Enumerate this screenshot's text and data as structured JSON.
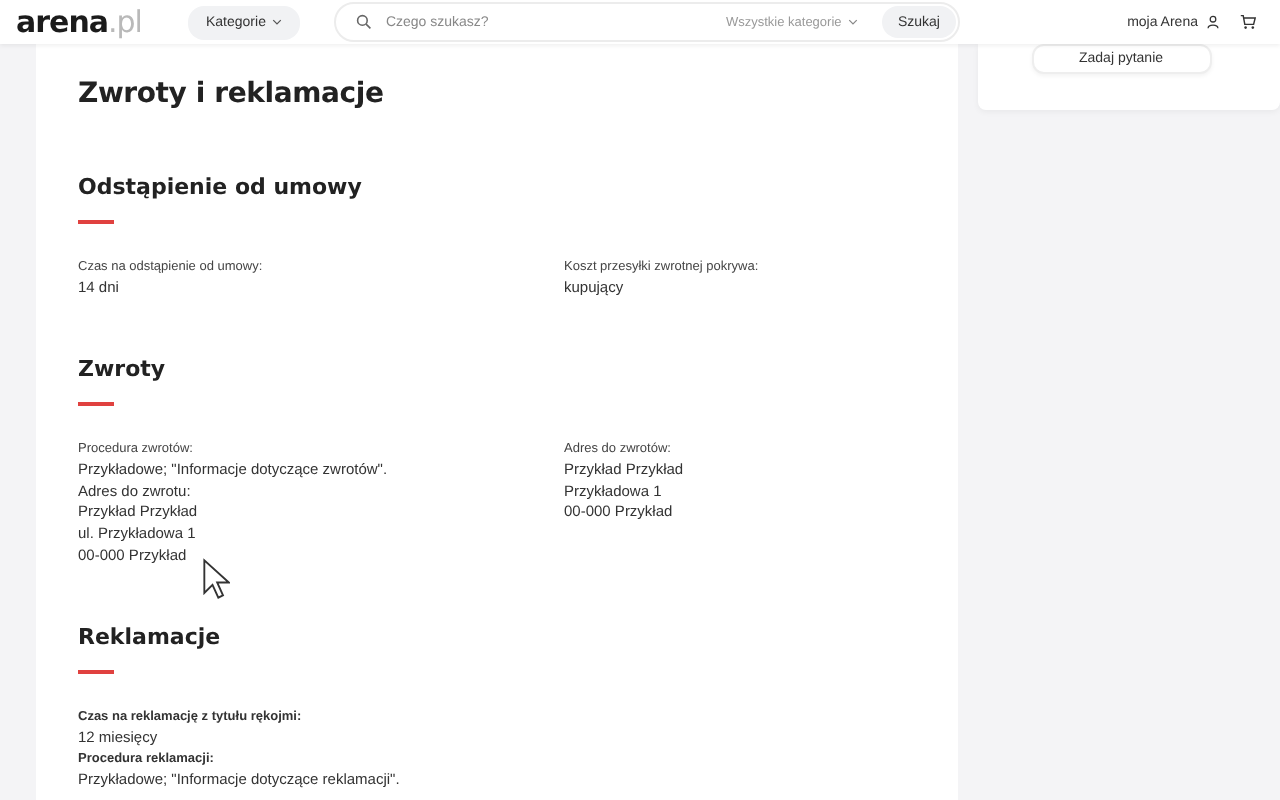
{
  "header": {
    "logo": {
      "name": "arena",
      "suffix": ".pl"
    },
    "categories_button": "Kategorie",
    "search": {
      "placeholder": "Czego szukasz?",
      "scope": "Wszystkie kategorie",
      "button": "Szukaj"
    },
    "account": "moja Arena"
  },
  "sidebar": {
    "button": "Zadaj pytanie"
  },
  "page": {
    "title": "Zwroty i reklamacje",
    "sections": [
      {
        "heading": "Odstąpienie od umowy",
        "columns": [
          [
            {
              "kind": "plain",
              "label": "Czas na odstąpienie od umowy:",
              "lines": [
                "14 dni"
              ]
            }
          ],
          [
            {
              "kind": "plain",
              "label": "Koszt przesyłki zwrotnej pokrywa:",
              "lines": [
                "kupujący"
              ]
            }
          ]
        ]
      },
      {
        "heading": "Zwroty",
        "columns": [
          [
            {
              "kind": "plain",
              "label": "Procedura zwrotów:",
              "lines": [
                "Przykładowe; \"Informacje dotyczące zwrotów\".",
                "Adres do zwrotu:",
                "Przykład Przykład",
                "ul. Przykładowa 1",
                "00-000 Przykład"
              ]
            }
          ],
          [
            {
              "kind": "plain",
              "label": "Adres do zwrotów:",
              "lines": [
                "Przykład Przykład",
                "Przykładowa 1",
                "00-000 Przykład"
              ]
            }
          ]
        ]
      },
      {
        "heading": "Reklamacje",
        "columns": [
          [
            {
              "kind": "strong",
              "label": "Czas na reklamację z tytułu rękojmi:",
              "lines": [
                "12 miesięcy"
              ]
            },
            {
              "kind": "strong",
              "label": "Procedura reklamacji:",
              "lines": [
                "Przykładowe; \"Informacje dotyczące reklamacji\"."
              ]
            }
          ]
        ]
      }
    ]
  }
}
